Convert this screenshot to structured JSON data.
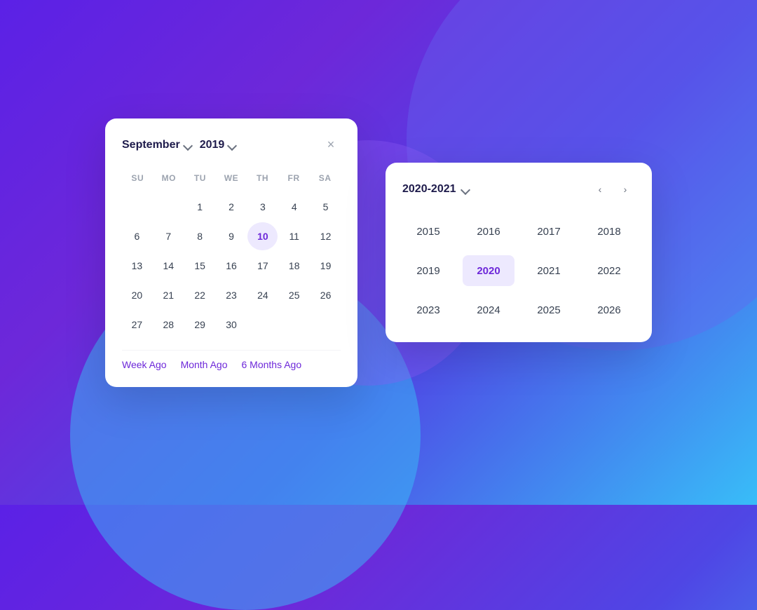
{
  "background": {
    "gradient": "linear-gradient(135deg, #5b21e6, #6d28d9, #4f46e5, #38bdf8)"
  },
  "calendar": {
    "month_label": "September",
    "year_label": "2019",
    "close_icon": "×",
    "day_headers": [
      "SU",
      "MO",
      "TU",
      "WE",
      "TH",
      "FR",
      "SA"
    ],
    "days": [
      {
        "day": "",
        "empty": true
      },
      {
        "day": "",
        "empty": true
      },
      {
        "day": "1",
        "selected": false
      },
      {
        "day": "2",
        "selected": false
      },
      {
        "day": "3",
        "selected": false
      },
      {
        "day": "4",
        "selected": false
      },
      {
        "day": "5",
        "selected": false
      },
      {
        "day": "6",
        "selected": false
      },
      {
        "day": "7",
        "selected": false
      },
      {
        "day": "8",
        "selected": false
      },
      {
        "day": "9",
        "selected": false
      },
      {
        "day": "10",
        "selected": true
      },
      {
        "day": "11",
        "selected": false
      },
      {
        "day": "12",
        "selected": false
      },
      {
        "day": "13",
        "selected": false
      },
      {
        "day": "14",
        "selected": false
      },
      {
        "day": "15",
        "selected": false
      },
      {
        "day": "16",
        "selected": false
      },
      {
        "day": "17",
        "selected": false
      },
      {
        "day": "18",
        "selected": false
      },
      {
        "day": "19",
        "selected": false
      },
      {
        "day": "20",
        "selected": false
      },
      {
        "day": "21",
        "selected": false
      },
      {
        "day": "22",
        "selected": false
      },
      {
        "day": "23",
        "selected": false
      },
      {
        "day": "24",
        "selected": false
      },
      {
        "day": "25",
        "selected": false
      },
      {
        "day": "26",
        "selected": false
      },
      {
        "day": "27",
        "selected": false
      },
      {
        "day": "28",
        "selected": false
      },
      {
        "day": "29",
        "selected": false
      },
      {
        "day": "30",
        "selected": false
      }
    ],
    "quick_links": [
      {
        "label": "Week Ago",
        "id": "week-ago"
      },
      {
        "label": "Month Ago",
        "id": "month-ago"
      },
      {
        "label": "6 Months Ago",
        "id": "six-months-ago"
      }
    ]
  },
  "year_picker": {
    "range_label": "2020-2021",
    "prev_arrow": "‹",
    "next_arrow": "›",
    "years": [
      {
        "year": "2015",
        "selected": false
      },
      {
        "year": "2016",
        "selected": false
      },
      {
        "year": "2017",
        "selected": false
      },
      {
        "year": "2018",
        "selected": false
      },
      {
        "year": "2019",
        "selected": false
      },
      {
        "year": "2020",
        "selected": true
      },
      {
        "year": "2021",
        "selected": false
      },
      {
        "year": "2022",
        "selected": false
      },
      {
        "year": "2023",
        "selected": false
      },
      {
        "year": "2024",
        "selected": false
      },
      {
        "year": "2025",
        "selected": false
      },
      {
        "year": "2026",
        "selected": false
      }
    ]
  }
}
